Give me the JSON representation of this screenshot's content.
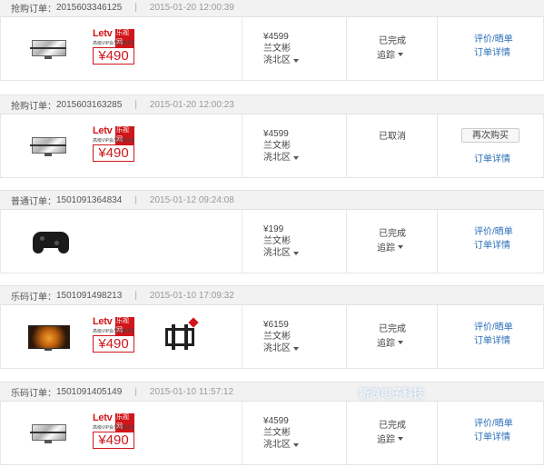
{
  "orders": [
    {
      "type_label": "抢购订单：",
      "order_no": "2015603346125",
      "time": "2015-01-20 12:00:39",
      "price": "¥4599",
      "name": "兰文彬",
      "region": "洮北区",
      "status": "已完成",
      "track_label": "追踪",
      "action1": "评价/晒单",
      "action2": "订单详情",
      "vip": {
        "logo": "Letv",
        "logo_cn": "乐视网",
        "sub": "高级VIP会员年服务费",
        "price": "¥490"
      }
    },
    {
      "type_label": "抢购订单：",
      "order_no": "2015603163285",
      "time": "2015-01-20 12:00:23",
      "price": "¥4599",
      "name": "兰文彬",
      "region": "洮北区",
      "status": "已取消",
      "rebuy_label": "再次购买",
      "action2": "订单详情",
      "vip": {
        "logo": "Letv",
        "logo_cn": "乐视网",
        "sub": "高级VIP会员年服务费",
        "price": "¥490"
      }
    },
    {
      "type_label": "普通订单：",
      "order_no": "1501091364834",
      "time": "2015-01-12 09:24:08",
      "price": "¥199",
      "name": "兰文彬",
      "region": "洮北区",
      "status": "已完成",
      "track_label": "追踪",
      "action1": "评价/晒单",
      "action2": "订单详情"
    },
    {
      "type_label": "乐码订单：",
      "order_no": "1501091498213",
      "time": "2015-01-10 17:09:32",
      "price": "¥6159",
      "name": "兰文彬",
      "region": "洮北区",
      "status": "已完成",
      "track_label": "追踪",
      "action1": "评价/晒单",
      "action2": "订单详情",
      "vip": {
        "logo": "Letv",
        "logo_cn": "乐视网",
        "sub": "高级VIP会员年服务费",
        "price": "¥490"
      }
    },
    {
      "type_label": "乐码订单：",
      "order_no": "1501091405149",
      "time": "2015-01-10 11:57:12",
      "price": "¥4599",
      "name": "兰文彬",
      "region": "洮北区",
      "status": "已完成",
      "track_label": "追踪",
      "action1": "评价/晒单",
      "action2": "订单详情",
      "vip": {
        "logo": "Letv",
        "logo_cn": "乐视网",
        "sub": "高级VIP会员年服务费",
        "price": "¥490"
      }
    }
  ],
  "separator": "|",
  "watermark": "新浪电子科技",
  "colors": {
    "accent_link": "#2a6fb8",
    "brand_red": "#d0161b",
    "header_bg": "#f2f2f2"
  }
}
